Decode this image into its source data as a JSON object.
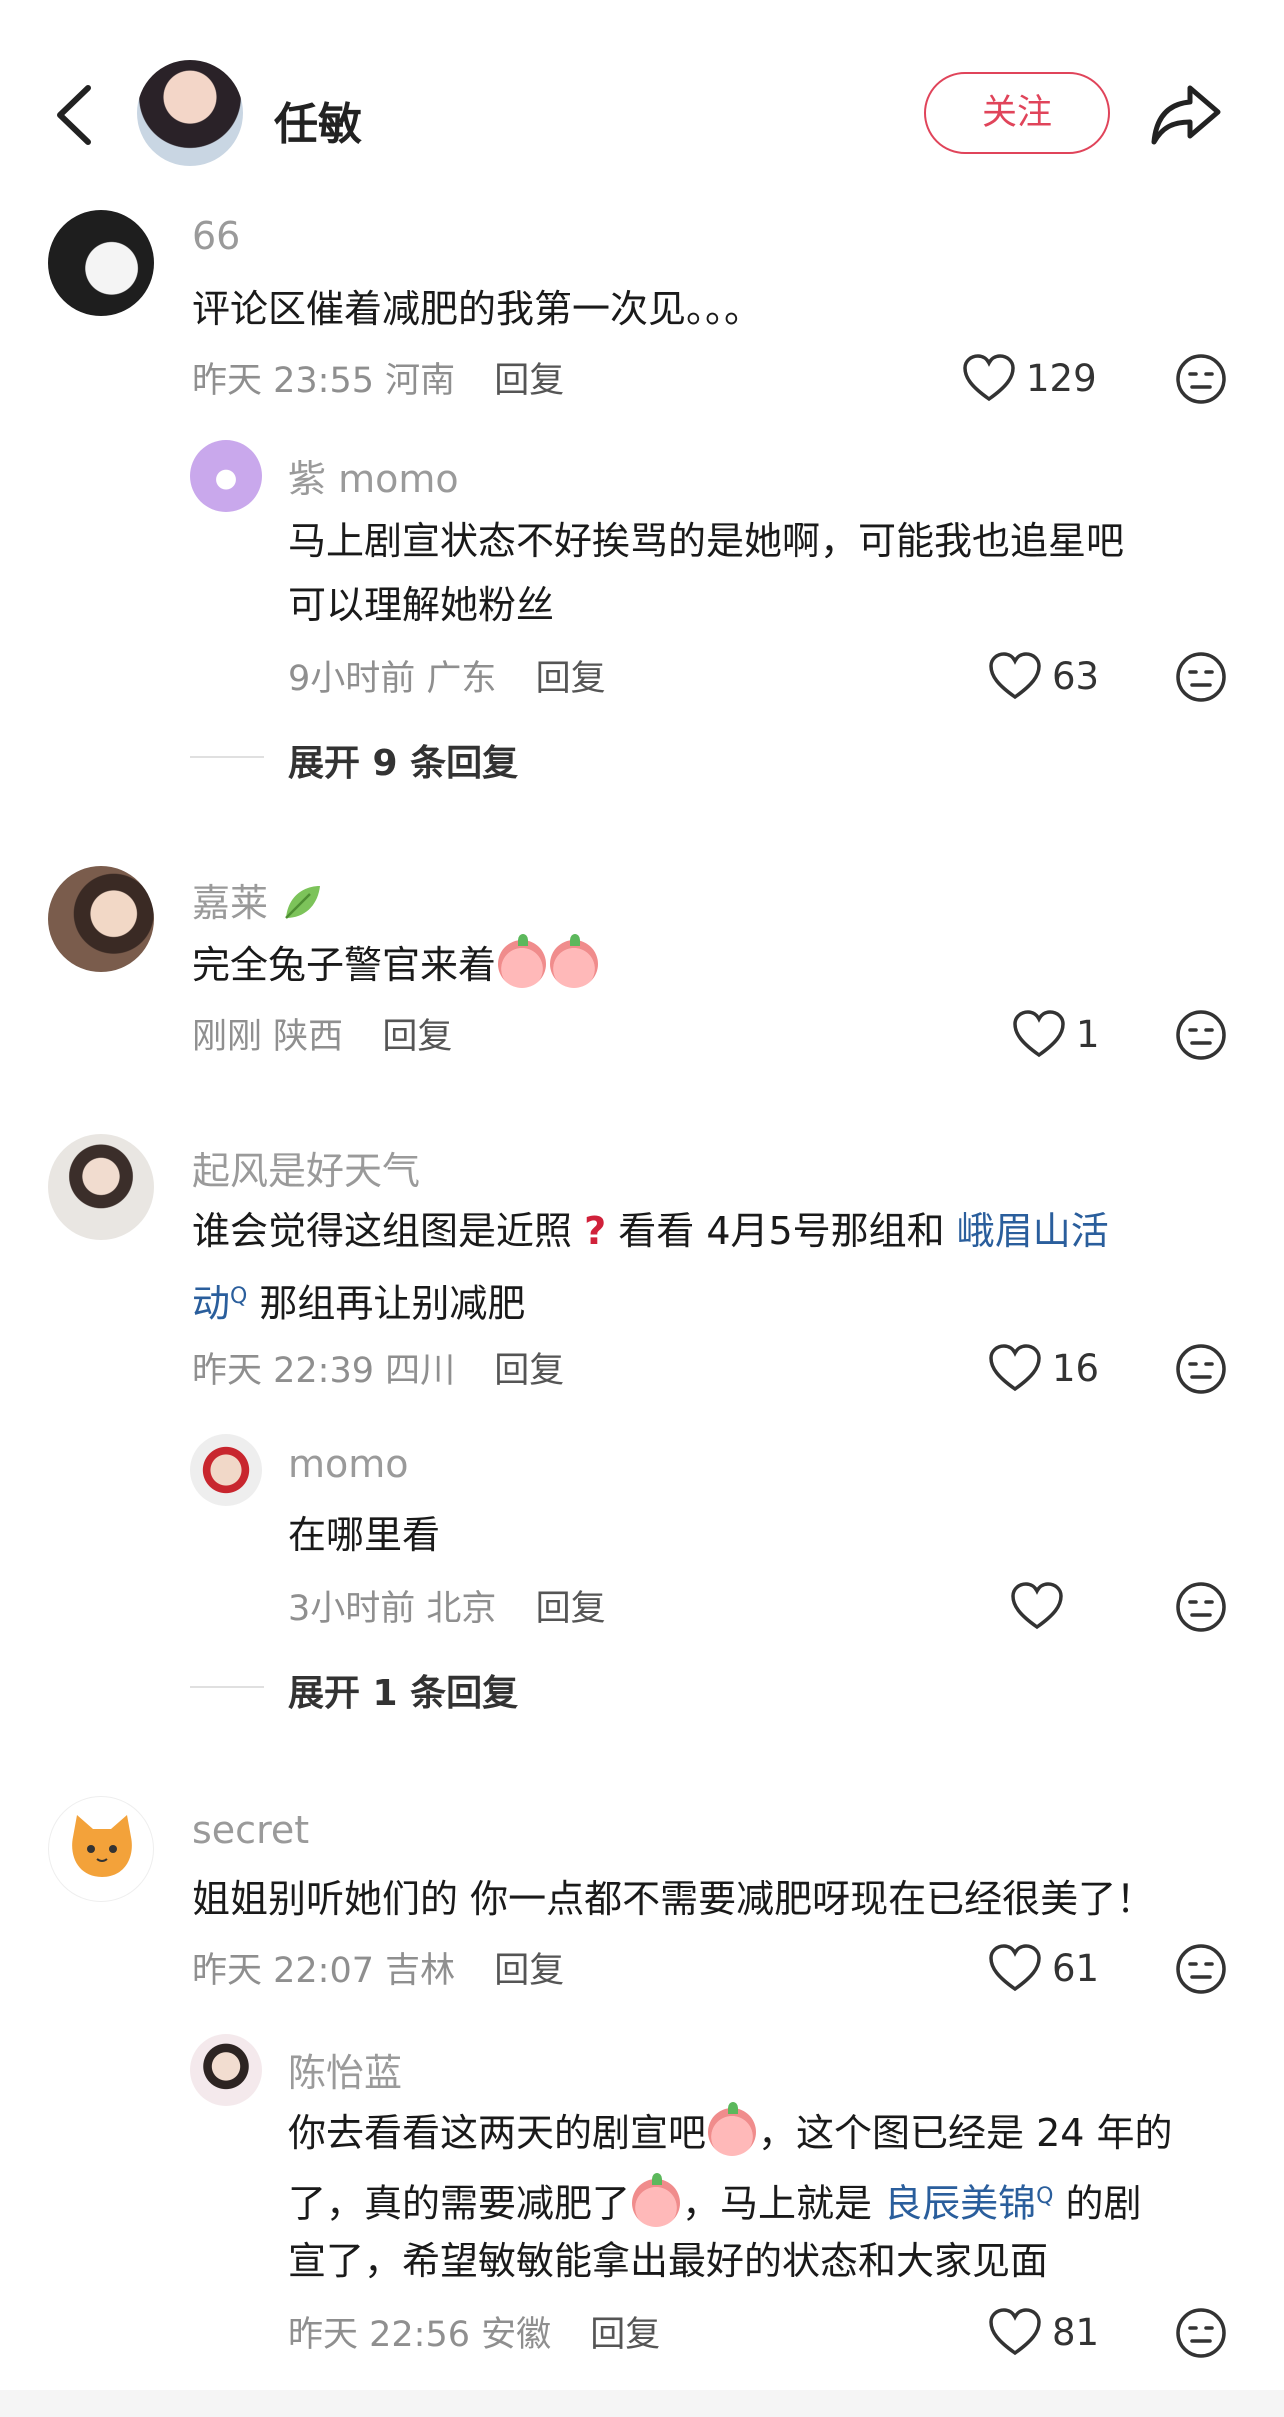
{
  "header": {
    "name": "任敏",
    "follow_label": "关注"
  },
  "comments": [
    {
      "user": "66",
      "text": "评论区催着减肥的我第一次见。。。",
      "time": "昨天 23:55",
      "location": "河南",
      "reply_label": "回复",
      "likes": "129",
      "sub": {
        "user": "紫 momo",
        "text_line1": "马上剧宣状态不好挨骂的是她啊，可能我也追星吧",
        "text_line2": "可以理解她粉丝",
        "time": "9小时前",
        "location": "广东",
        "reply_label": "回复",
        "likes": "63"
      },
      "expand": "展开 9 条回复"
    },
    {
      "user": "嘉莱",
      "text": "完全兔子警官来着",
      "time": "刚刚",
      "location": "陕西",
      "reply_label": "回复",
      "likes": "1"
    },
    {
      "user": "起风是好天气",
      "text_a": "谁会觉得这组图是近照",
      "text_b": " 看看 4月5号那组和 ",
      "link": "峨眉山活",
      "link2": "动",
      "text_c": " 那组再让别减肥",
      "time": "昨天 22:39",
      "location": "四川",
      "reply_label": "回复",
      "likes": "16",
      "sub": {
        "user": "momo",
        "text": "在哪里看",
        "time": "3小时前",
        "location": "北京",
        "reply_label": "回复",
        "likes": ""
      },
      "expand": "展开 1 条回复"
    },
    {
      "user": "secret",
      "text": "姐姐别听她们的 你一点都不需要减肥呀现在已经很美了！",
      "time": "昨天 22:07",
      "location": "吉林",
      "reply_label": "回复",
      "likes": "61",
      "sub": {
        "user": "陈怡蓝",
        "line1_a": "你去看看这两天的剧宣吧",
        "line1_b": "，这个图已经是 24 年的",
        "line2_a": "了，真的需要减肥了",
        "line2_b": "，马上就是 ",
        "line2_link": "良辰美锦",
        "line2_c": " 的剧",
        "line3": "宣了，希望敏敏能拿出最好的状态和大家见面",
        "time": "昨天 22:56",
        "location": "安徽",
        "reply_label": "回复",
        "likes": "81"
      }
    }
  ],
  "search_mark": "Q"
}
